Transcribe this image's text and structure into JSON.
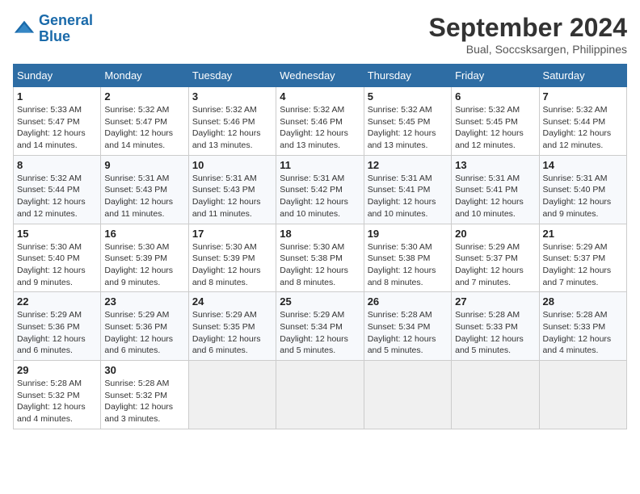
{
  "header": {
    "logo_line1": "General",
    "logo_line2": "Blue",
    "title": "September 2024",
    "subtitle": "Bual, Soccsksargen, Philippines"
  },
  "weekdays": [
    "Sunday",
    "Monday",
    "Tuesday",
    "Wednesday",
    "Thursday",
    "Friday",
    "Saturday"
  ],
  "weeks": [
    [
      {
        "day": "1",
        "sunrise": "Sunrise: 5:33 AM",
        "sunset": "Sunset: 5:47 PM",
        "daylight": "Daylight: 12 hours and 14 minutes."
      },
      {
        "day": "2",
        "sunrise": "Sunrise: 5:32 AM",
        "sunset": "Sunset: 5:47 PM",
        "daylight": "Daylight: 12 hours and 14 minutes."
      },
      {
        "day": "3",
        "sunrise": "Sunrise: 5:32 AM",
        "sunset": "Sunset: 5:46 PM",
        "daylight": "Daylight: 12 hours and 13 minutes."
      },
      {
        "day": "4",
        "sunrise": "Sunrise: 5:32 AM",
        "sunset": "Sunset: 5:46 PM",
        "daylight": "Daylight: 12 hours and 13 minutes."
      },
      {
        "day": "5",
        "sunrise": "Sunrise: 5:32 AM",
        "sunset": "Sunset: 5:45 PM",
        "daylight": "Daylight: 12 hours and 13 minutes."
      },
      {
        "day": "6",
        "sunrise": "Sunrise: 5:32 AM",
        "sunset": "Sunset: 5:45 PM",
        "daylight": "Daylight: 12 hours and 12 minutes."
      },
      {
        "day": "7",
        "sunrise": "Sunrise: 5:32 AM",
        "sunset": "Sunset: 5:44 PM",
        "daylight": "Daylight: 12 hours and 12 minutes."
      }
    ],
    [
      {
        "day": "8",
        "sunrise": "Sunrise: 5:32 AM",
        "sunset": "Sunset: 5:44 PM",
        "daylight": "Daylight: 12 hours and 12 minutes."
      },
      {
        "day": "9",
        "sunrise": "Sunrise: 5:31 AM",
        "sunset": "Sunset: 5:43 PM",
        "daylight": "Daylight: 12 hours and 11 minutes."
      },
      {
        "day": "10",
        "sunrise": "Sunrise: 5:31 AM",
        "sunset": "Sunset: 5:43 PM",
        "daylight": "Daylight: 12 hours and 11 minutes."
      },
      {
        "day": "11",
        "sunrise": "Sunrise: 5:31 AM",
        "sunset": "Sunset: 5:42 PM",
        "daylight": "Daylight: 12 hours and 10 minutes."
      },
      {
        "day": "12",
        "sunrise": "Sunrise: 5:31 AM",
        "sunset": "Sunset: 5:41 PM",
        "daylight": "Daylight: 12 hours and 10 minutes."
      },
      {
        "day": "13",
        "sunrise": "Sunrise: 5:31 AM",
        "sunset": "Sunset: 5:41 PM",
        "daylight": "Daylight: 12 hours and 10 minutes."
      },
      {
        "day": "14",
        "sunrise": "Sunrise: 5:31 AM",
        "sunset": "Sunset: 5:40 PM",
        "daylight": "Daylight: 12 hours and 9 minutes."
      }
    ],
    [
      {
        "day": "15",
        "sunrise": "Sunrise: 5:30 AM",
        "sunset": "Sunset: 5:40 PM",
        "daylight": "Daylight: 12 hours and 9 minutes."
      },
      {
        "day": "16",
        "sunrise": "Sunrise: 5:30 AM",
        "sunset": "Sunset: 5:39 PM",
        "daylight": "Daylight: 12 hours and 9 minutes."
      },
      {
        "day": "17",
        "sunrise": "Sunrise: 5:30 AM",
        "sunset": "Sunset: 5:39 PM",
        "daylight": "Daylight: 12 hours and 8 minutes."
      },
      {
        "day": "18",
        "sunrise": "Sunrise: 5:30 AM",
        "sunset": "Sunset: 5:38 PM",
        "daylight": "Daylight: 12 hours and 8 minutes."
      },
      {
        "day": "19",
        "sunrise": "Sunrise: 5:30 AM",
        "sunset": "Sunset: 5:38 PM",
        "daylight": "Daylight: 12 hours and 8 minutes."
      },
      {
        "day": "20",
        "sunrise": "Sunrise: 5:29 AM",
        "sunset": "Sunset: 5:37 PM",
        "daylight": "Daylight: 12 hours and 7 minutes."
      },
      {
        "day": "21",
        "sunrise": "Sunrise: 5:29 AM",
        "sunset": "Sunset: 5:37 PM",
        "daylight": "Daylight: 12 hours and 7 minutes."
      }
    ],
    [
      {
        "day": "22",
        "sunrise": "Sunrise: 5:29 AM",
        "sunset": "Sunset: 5:36 PM",
        "daylight": "Daylight: 12 hours and 6 minutes."
      },
      {
        "day": "23",
        "sunrise": "Sunrise: 5:29 AM",
        "sunset": "Sunset: 5:36 PM",
        "daylight": "Daylight: 12 hours and 6 minutes."
      },
      {
        "day": "24",
        "sunrise": "Sunrise: 5:29 AM",
        "sunset": "Sunset: 5:35 PM",
        "daylight": "Daylight: 12 hours and 6 minutes."
      },
      {
        "day": "25",
        "sunrise": "Sunrise: 5:29 AM",
        "sunset": "Sunset: 5:34 PM",
        "daylight": "Daylight: 12 hours and 5 minutes."
      },
      {
        "day": "26",
        "sunrise": "Sunrise: 5:28 AM",
        "sunset": "Sunset: 5:34 PM",
        "daylight": "Daylight: 12 hours and 5 minutes."
      },
      {
        "day": "27",
        "sunrise": "Sunrise: 5:28 AM",
        "sunset": "Sunset: 5:33 PM",
        "daylight": "Daylight: 12 hours and 5 minutes."
      },
      {
        "day": "28",
        "sunrise": "Sunrise: 5:28 AM",
        "sunset": "Sunset: 5:33 PM",
        "daylight": "Daylight: 12 hours and 4 minutes."
      }
    ],
    [
      {
        "day": "29",
        "sunrise": "Sunrise: 5:28 AM",
        "sunset": "Sunset: 5:32 PM",
        "daylight": "Daylight: 12 hours and 4 minutes."
      },
      {
        "day": "30",
        "sunrise": "Sunrise: 5:28 AM",
        "sunset": "Sunset: 5:32 PM",
        "daylight": "Daylight: 12 hours and 3 minutes."
      },
      null,
      null,
      null,
      null,
      null
    ]
  ]
}
